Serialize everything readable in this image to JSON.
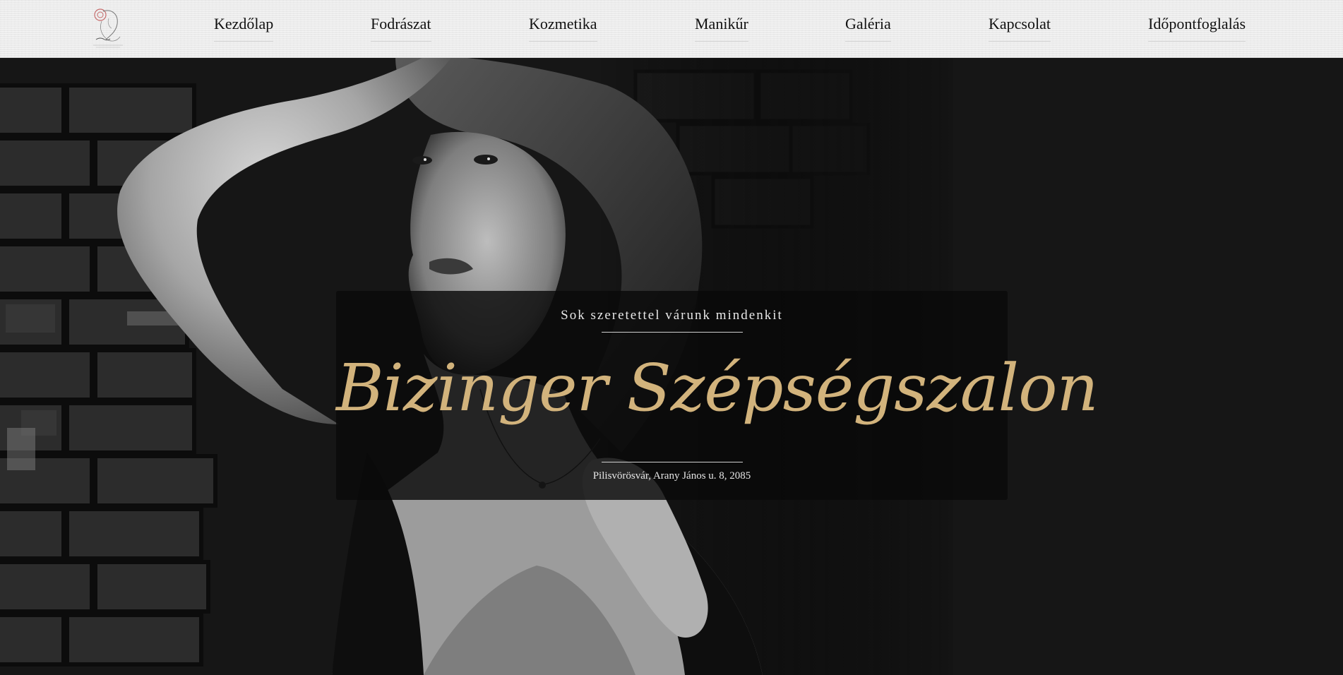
{
  "nav": {
    "logo_icon": "salon-logo-icon",
    "items": [
      {
        "label": "Kezdőlap"
      },
      {
        "label": "Fodrászat"
      },
      {
        "label": "Kozmetika"
      },
      {
        "label": "Manikűr"
      },
      {
        "label": "Galéria"
      },
      {
        "label": "Kapcsolat"
      },
      {
        "label": "Időpontfoglalás"
      }
    ]
  },
  "hero": {
    "tagline": "Sok szeretettel várunk mindenkit",
    "brand": "Bizinger Szépségszalon",
    "address": "Pilisvörösvár, Arany János u. 8, 2085",
    "image": "black-and-white-portrait-photo",
    "accent_color": "#d2b37c"
  }
}
